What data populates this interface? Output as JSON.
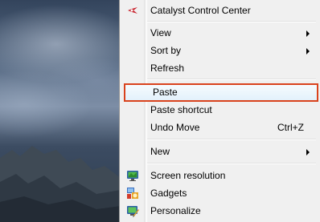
{
  "desktop": {
    "wallpaper": "mountain-landscape"
  },
  "menu": {
    "items": [
      {
        "label": "Catalyst Control Center",
        "icon": "catalyst-icon"
      },
      {
        "label": "View",
        "has_submenu": true
      },
      {
        "label": "Sort by",
        "has_submenu": true
      },
      {
        "label": "Refresh"
      },
      {
        "label": "Paste",
        "highlighted": true
      },
      {
        "label": "Paste shortcut"
      },
      {
        "label": "Undo Move",
        "shortcut": "Ctrl+Z"
      },
      {
        "label": "New",
        "has_submenu": true
      },
      {
        "label": "Screen resolution",
        "icon": "screen-resolution-icon"
      },
      {
        "label": "Gadgets",
        "icon": "gadgets-icon"
      },
      {
        "label": "Personalize",
        "icon": "personalize-icon"
      }
    ]
  },
  "colors": {
    "highlight_border": "#d9421c",
    "menu_bg": "#f0f0f0"
  }
}
